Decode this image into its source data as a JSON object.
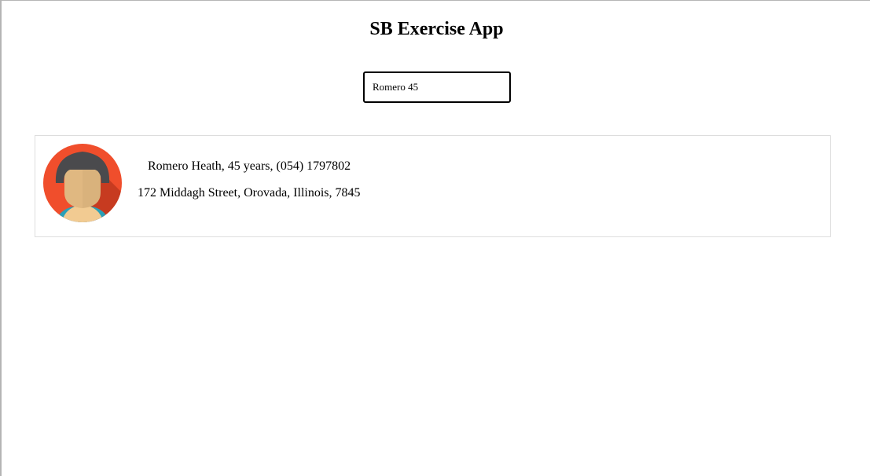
{
  "header": {
    "title": "SB Exercise App"
  },
  "search": {
    "value": "Romero 45"
  },
  "results": [
    {
      "name_line": "Romero Heath, 45 years, (054) 1797802",
      "address_line": "172 Middagh Street, Orovada, Illinois, 7845",
      "avatar_icon": "female-avatar-icon"
    }
  ],
  "colors": {
    "avatar_background": "#f04e2c",
    "avatar_background_shade": "#c73b20",
    "hair": "#4a4a4d",
    "skin": "#d9b27c",
    "skin_light": "#f2cb92",
    "shirt": "#2aa0b8",
    "card_border": "#dddddd",
    "frame_border": "#b5b5b5"
  }
}
